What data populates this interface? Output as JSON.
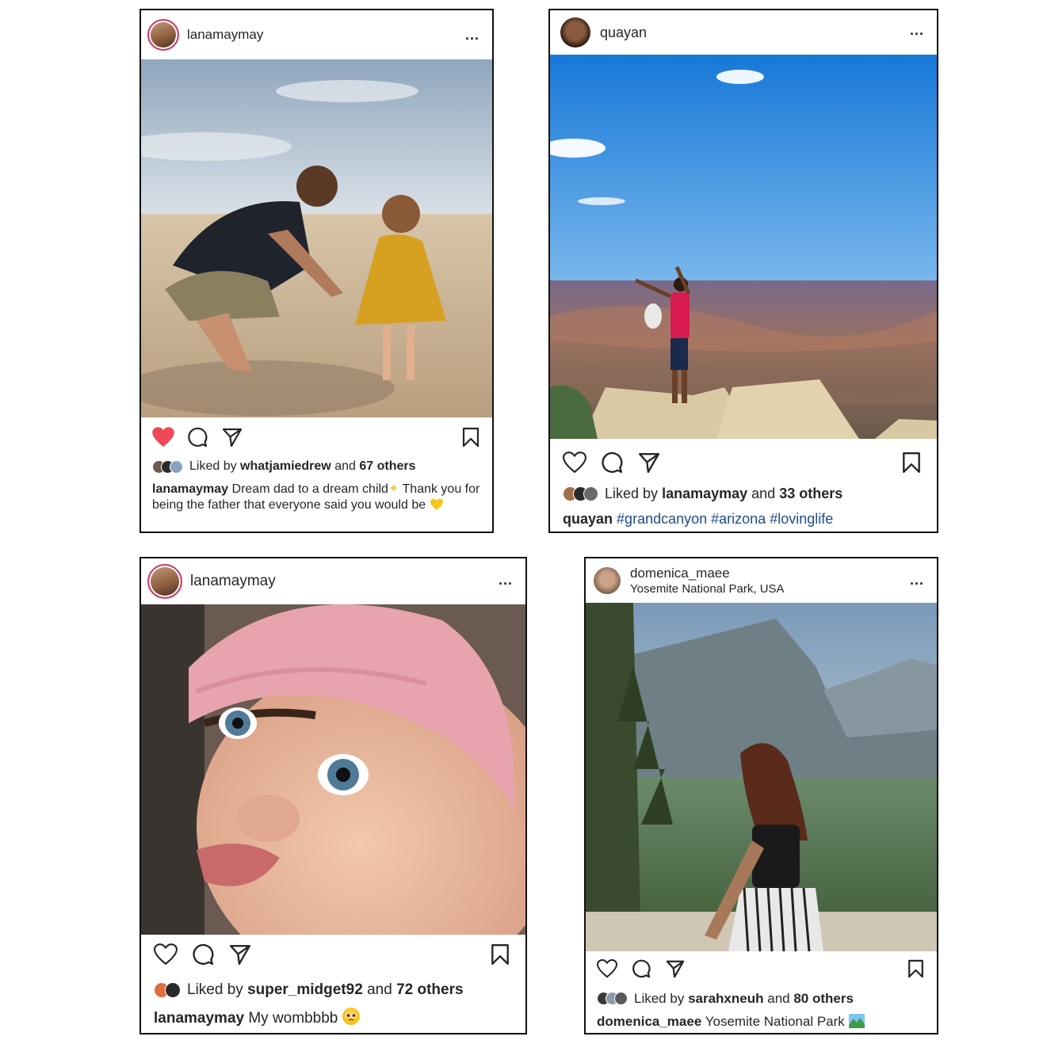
{
  "posts": [
    {
      "username": "lanamaymay",
      "more_label": "...",
      "liked_by_prefix": "Liked by",
      "liked_by_user": "whatjamiedrew",
      "and_text": "and",
      "others_text": "67 others",
      "caption_user": "lanamaymay",
      "caption_text": "Dream dad to a dream child",
      "caption_text_2": "Thank you for being the father that everyone said you would be",
      "liked": true,
      "colors": {
        "like": "#ed4956"
      },
      "emojis": [
        "sparkles",
        "yellow-heart"
      ]
    },
    {
      "username": "quayan",
      "more_label": "...",
      "liked_by_prefix": "Liked by",
      "liked_by_user": "lanamaymay",
      "and_text": "and",
      "others_text": "33 others",
      "caption_user": "quayan",
      "hashtags": [
        "#grandcanyon",
        "#arizona",
        "#lovinglife"
      ],
      "liked": false,
      "colors": {
        "hashtag": "#1f4c8a"
      }
    },
    {
      "username": "lanamaymay",
      "more_label": "...",
      "liked_by_prefix": "Liked by",
      "liked_by_user": "super_midget92",
      "and_text": "and",
      "others_text": "72 others",
      "caption_user": "lanamaymay",
      "caption_text": "My wombbbb",
      "liked": false,
      "emojis": [
        "pleading-face"
      ]
    },
    {
      "username": "domenica_maee",
      "location": "Yosemite National Park, USA",
      "more_label": "...",
      "liked_by_prefix": "Liked by",
      "liked_by_user": "sarahxneuh",
      "and_text": "and",
      "others_text": "80 others",
      "caption_user": "domenica_maee",
      "caption_text": "Yosemite National Park",
      "liked": false,
      "emojis": [
        "national-park"
      ]
    }
  ]
}
